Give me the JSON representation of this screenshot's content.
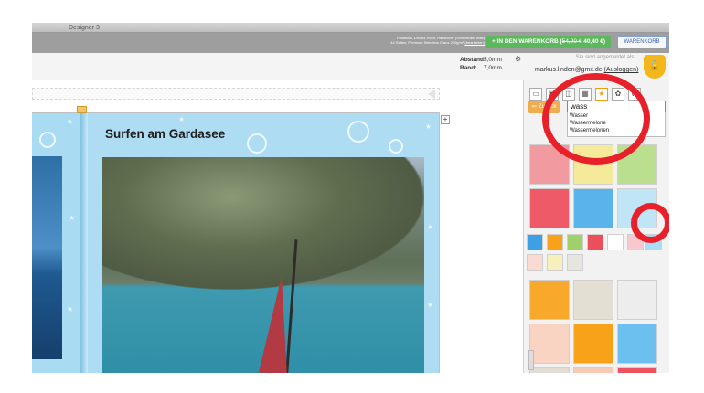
{
  "window": {
    "title": "Designer 3"
  },
  "topbar": {
    "product_line1": "Fotobuch, DIN A4 Hoch, Hardcover (Schutzfolie/ matt)",
    "product_line2": "44 Seiten, Premium Selection Glanz 200g/m²",
    "edit_link": "(bearbeiten)",
    "cart_button_label": "+ IN DEN WARENKORB",
    "old_price": "54,90 €",
    "new_price": "40,40 €",
    "cart_link_label": "WARENKORB"
  },
  "toolbar": {
    "spacing_label": "Abstand:",
    "spacing_value": "5,0mm",
    "border_label": "Rand:",
    "border_value": "7,0mm",
    "login_label": "Sie sind angemeldet als:",
    "user_email": "markus.linden@gmx.de",
    "logout_link": "(Ausloggen)"
  },
  "page": {
    "title": "Surfen am Gardasee"
  },
  "sidebar": {
    "back_label": "Zurück",
    "search_value": "wass",
    "suggestions": [
      "Wasser",
      "Wassermelone",
      "Wassermelonen"
    ]
  },
  "colors": {
    "accent": "#5cb85c",
    "highlight_circle": "#e8202a",
    "lock": "#f3b71b",
    "back_button": "#f0ad4e"
  }
}
